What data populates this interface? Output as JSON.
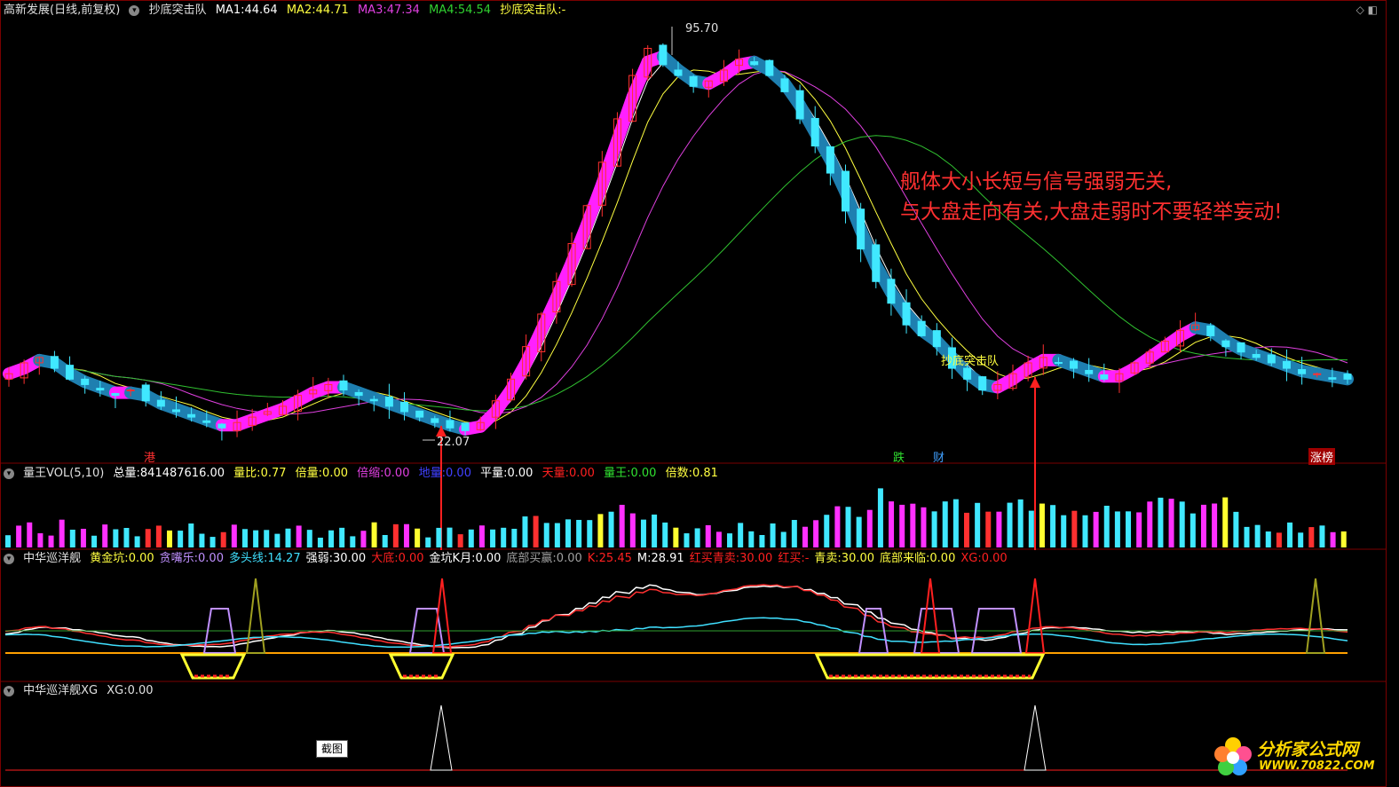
{
  "main_header": {
    "stock_name": "高新发展(日线,前复权)",
    "indicator_name": "抄底突击队",
    "ma1_label": "MA1:",
    "ma1_value": "44.64",
    "ma2_label": "MA2:",
    "ma2_value": "44.71",
    "ma3_label": "MA3:",
    "ma3_value": "47.34",
    "ma4_label": "MA4:",
    "ma4_value": "54.54",
    "signal_label": "抄底突击队:",
    "signal_value": "-"
  },
  "price_labels": {
    "high": "95.70",
    "low": "22.07",
    "signal_tag": "抄底突击队"
  },
  "event_tags": {
    "gang": "港",
    "die": "跌",
    "cai": "财",
    "zhangbang": "涨榜"
  },
  "annotation": {
    "line1": "舰体大小长短与信号强弱无关,",
    "line2": "与大盘走向有关,大盘走弱时不要轻举妄动!"
  },
  "vol_header": {
    "title": "量王VOL(5,10)",
    "total_label": "总量:",
    "total_value": "841487616.00",
    "ratio_label": "量比:",
    "ratio_value": "0.77",
    "double_label": "倍量:",
    "double_value": "0.00",
    "shrink_label": "倍缩:",
    "shrink_value": "0.00",
    "low_label": "地量:",
    "low_value": "0.00",
    "flat_label": "平量:",
    "flat_value": "0.00",
    "sky_label": "天量:",
    "sky_value": "0.00",
    "king_label": "量王:",
    "king_value": "0.00",
    "times_label": "倍数:",
    "times_value": "0.81"
  },
  "cruiser_header": {
    "title": "中华巡洋舰",
    "items": [
      {
        "label": "黄金坑:",
        "value": "0.00",
        "color": "#ffff40"
      },
      {
        "label": "贪嘴乐:",
        "value": "0.00",
        "color": "#c090ff"
      },
      {
        "label": "多头线:",
        "value": "14.27",
        "color": "#40e0ff"
      },
      {
        "label": "强弱:",
        "value": "30.00",
        "color": "#ffffff"
      },
      {
        "label": "大底:",
        "value": "0.00",
        "color": "#ff2020"
      },
      {
        "label": "金坑K月:",
        "value": "0.00",
        "color": "#ffffff"
      },
      {
        "label": "底部买赢:",
        "value": "0.00",
        "color": "#a0a0a0"
      },
      {
        "label": "K:",
        "value": "25.45",
        "color": "#ff2020"
      },
      {
        "label": "M:",
        "value": "28.91",
        "color": "#ffffff"
      },
      {
        "label": "红买青卖:",
        "value": "30.00",
        "color": "#ff2020"
      },
      {
        "label": "红买:",
        "value": "-",
        "color": "#ff2020"
      },
      {
        "label": "青卖:",
        "value": "30.00",
        "color": "#ffff40"
      },
      {
        "label": "底部来临:",
        "value": "0.00",
        "color": "#ffff40"
      },
      {
        "label": "XG:",
        "value": "0.00",
        "color": "#ff2020"
      }
    ]
  },
  "xg_header": {
    "title": "中华巡洋舰XG",
    "xg_label": "XG:",
    "xg_value": "0.00"
  },
  "screenshot_button": "截图",
  "watermark": "分析家公式网www.70822.com",
  "logo": {
    "name": "分析家公式网",
    "url": "WWW.70822.COM"
  },
  "colors": {
    "up_candle": "#ff3030",
    "down_candle": "#40e8ff",
    "ribbon_up": "#ff20ff",
    "ribbon_down": "#1e7fb0",
    "ma1": "#ffffff",
    "ma2": "#ffff40",
    "ma3": "#e040e0",
    "ma4": "#30c030",
    "border": "#7a0000"
  },
  "chart_data": {
    "type": "candlestick",
    "price_range": [
      22.07,
      95.7
    ],
    "close": [
      33,
      35,
      36,
      34,
      32,
      31,
      30,
      29,
      30,
      28,
      27,
      26,
      25,
      24,
      23,
      24,
      25,
      26,
      27,
      29,
      30,
      31,
      30,
      29,
      28,
      27,
      26,
      25,
      24,
      23,
      22.5,
      24,
      28,
      32,
      38,
      44,
      50,
      57,
      64,
      72,
      80,
      88,
      93,
      90,
      88,
      86,
      87,
      89,
      91,
      90,
      88,
      85,
      80,
      75,
      70,
      63,
      56,
      50,
      46,
      42,
      40,
      38,
      34,
      32,
      30,
      31,
      33,
      35,
      36,
      35,
      34,
      33,
      32,
      33,
      35,
      37,
      39,
      41,
      42,
      40,
      38,
      37,
      36,
      35,
      34,
      33,
      33,
      32,
      32
    ],
    "volume_max": 100
  }
}
